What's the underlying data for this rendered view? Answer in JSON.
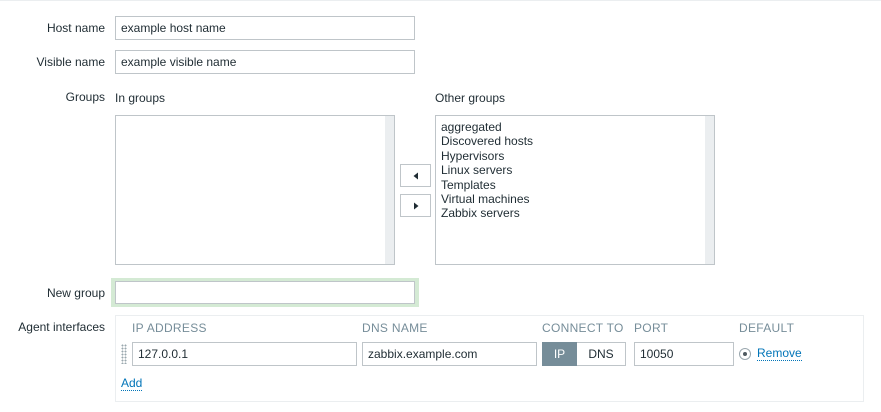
{
  "form": {
    "host_name": {
      "label": "Host name",
      "value": "example host name"
    },
    "visible_name": {
      "label": "Visible name",
      "value": "example visible name"
    },
    "groups": {
      "label": "Groups",
      "in_groups_title": "In groups",
      "other_groups_title": "Other groups",
      "in_groups": [],
      "other_groups": [
        "aggregated",
        "Discovered hosts",
        "Hypervisors",
        "Linux servers",
        "Templates",
        "Virtual machines",
        "Zabbix servers"
      ]
    },
    "new_group": {
      "label": "New group",
      "value": ""
    },
    "agent_interfaces": {
      "label": "Agent interfaces",
      "columns": {
        "ip_address": "IP ADDRESS",
        "dns_name": "DNS NAME",
        "connect_to": "CONNECT TO",
        "port": "PORT",
        "default": "DEFAULT"
      },
      "rows": [
        {
          "ip": "127.0.0.1",
          "dns": "zabbix.example.com",
          "connect_options": [
            "IP",
            "DNS"
          ],
          "connect_selected": "IP",
          "port": "10050",
          "is_default": true,
          "remove_label": "Remove"
        }
      ],
      "add_label": "Add"
    }
  },
  "colors": {
    "text": "#1f2c33",
    "border": "#bfc5c9",
    "link": "#0275b8",
    "toggle_selected": "#768d99",
    "focus_ring": "#d4ead4",
    "header_text": "#768d99"
  },
  "icons": {
    "move_left": "triangle-left",
    "move_right": "triangle-right",
    "drag": "drag-handle-dots"
  }
}
